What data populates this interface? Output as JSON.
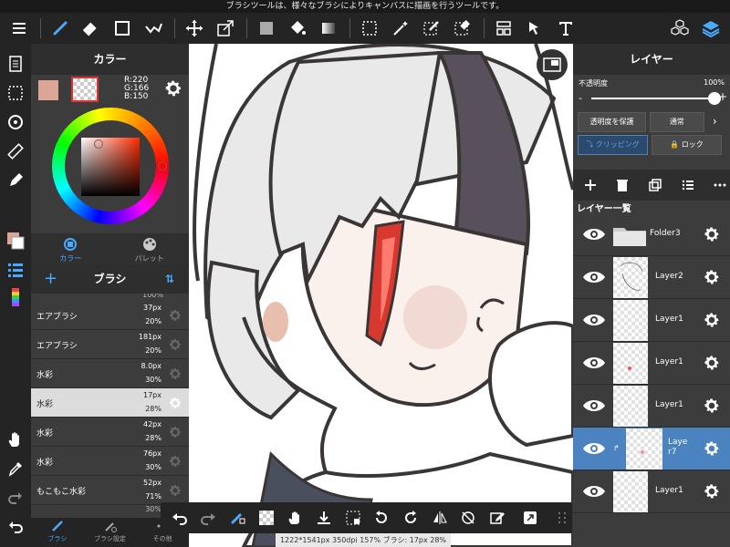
{
  "status_bar": {
    "message": "ブラシツールは、様々なブラシによりキャンバスに描画を行うツールです。"
  },
  "toolbar": {
    "icons": [
      "menu-icon",
      "brush-icon",
      "eraser-icon",
      "rect-select-icon",
      "correction-icon",
      "move-icon",
      "transform-icon",
      "fill-color-icon",
      "bucket-icon",
      "gradient-icon",
      "select-rect-icon",
      "magic-wand-icon",
      "select-pen-icon",
      "select-eraser-icon",
      "layout-icon",
      "select-layer-icon",
      "text-icon",
      "materials-icon",
      "layers-icon"
    ]
  },
  "color_panel": {
    "title": "カラー",
    "r": "R:220",
    "g": "G:166",
    "b": "B:150",
    "main_color": "#dca696",
    "tab_color": "カラー",
    "tab_palette": "パレット"
  },
  "brush_panel": {
    "title": "ブラシ",
    "top_partial": "100%",
    "items": [
      {
        "name": "エアブラシ",
        "size": "37px",
        "opacity": "20%"
      },
      {
        "name": "エアブラシ",
        "size": "181px",
        "opacity": "20%"
      },
      {
        "name": "水彩",
        "size": "8.0px",
        "opacity": "30%"
      },
      {
        "name": "水彩",
        "size": "17px",
        "opacity": "28%"
      },
      {
        "name": "水彩",
        "size": "42px",
        "opacity": "28%"
      },
      {
        "name": "水彩",
        "size": "76px",
        "opacity": "30%"
      },
      {
        "name": "もこもこ水彩",
        "size": "52px",
        "opacity": "71%"
      }
    ],
    "bottom_partial": "30%"
  },
  "bottom_tabs": {
    "brush": "ブラシ",
    "brush_settings": "ブラシ設定",
    "other": "その他"
  },
  "canvas_info": "1222*1541px 350dpi 157% ブラシ: 17px 28%",
  "layer_panel": {
    "title": "レイヤー",
    "opacity_label": "不透明度",
    "opacity_value": "100%",
    "opacity_fraction": 1.0,
    "protect_alpha": "透明度を保護",
    "blend_mode": "通常",
    "clipping": "クリッピング",
    "lock": "ロック",
    "list_title": "レイヤー一覧",
    "layers": [
      {
        "name": "Folder3"
      },
      {
        "name": "Layer2"
      },
      {
        "name": "Layer1"
      },
      {
        "name": "Layer1"
      },
      {
        "name": "Layer1"
      },
      {
        "name": "Laye\nr7",
        "selected": true
      },
      {
        "name": "Layer1"
      }
    ]
  },
  "colors": {
    "accent": "#4aa8ff",
    "selected_layer": "#4a83bf",
    "panel": "#3c3c3c"
  }
}
